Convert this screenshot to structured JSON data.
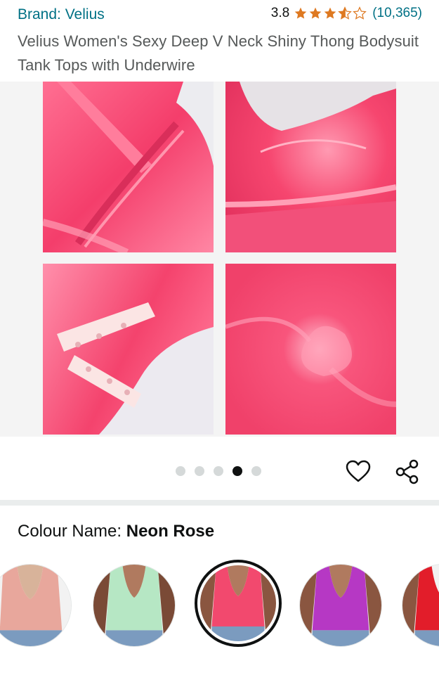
{
  "product": {
    "brand": "Brand: Velius",
    "rating_value": "3.8",
    "rating_stars": 3.8,
    "rating_count": "(10,365)",
    "title": "Velius Women's Sexy Deep V Neck Shiny Thong Bodysuit Tank Tops with Underwire"
  },
  "gallery": {
    "image_count": 5,
    "active_index": 4,
    "images": [
      {
        "name": "shoulder-strap-detail"
      },
      {
        "name": "underwire-cup-detail"
      },
      {
        "name": "snap-crotch-detail"
      },
      {
        "name": "satin-fabric-detail"
      }
    ]
  },
  "colour": {
    "label": "Colour Name:",
    "selected": "Neon Rose",
    "options": [
      {
        "name": "nude-pink",
        "color": "#e8a79c"
      },
      {
        "name": "mint-green",
        "color": "#b6e7c4"
      },
      {
        "name": "neon-rose",
        "color": "#f2496e"
      },
      {
        "name": "purple",
        "color": "#b638c4"
      },
      {
        "name": "red",
        "color": "#e21d2a"
      }
    ]
  },
  "colors": {
    "link": "#007185",
    "star": "#de7921",
    "satin": "#f54d76"
  },
  "icons": [
    "star-icon",
    "heart-icon",
    "share-icon"
  ]
}
